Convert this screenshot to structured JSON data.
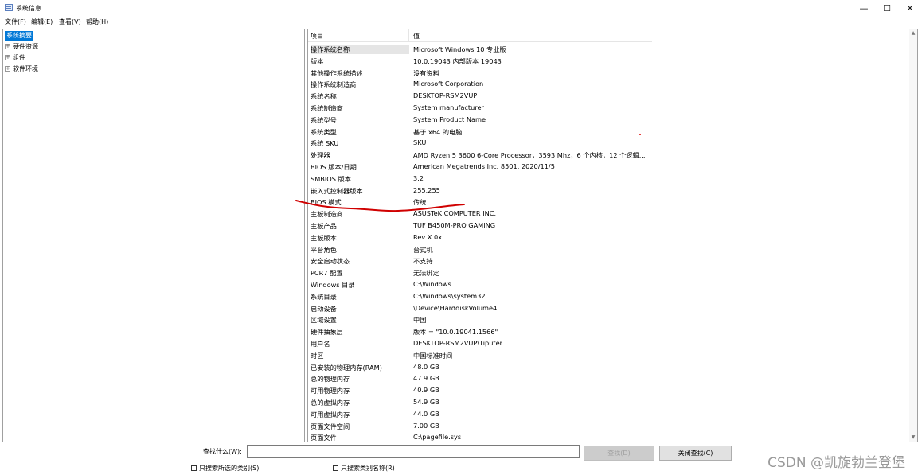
{
  "window": {
    "title": "系统信息",
    "minimize": "—",
    "maximize": "☐",
    "close": "✕"
  },
  "menu": [
    "文件(F)",
    "编辑(E)",
    "查看(V)",
    "帮助(H)"
  ],
  "tree": {
    "root": "系统摘要",
    "children": [
      "硬件资源",
      "组件",
      "软件环境"
    ]
  },
  "list": {
    "header": {
      "item": "项目",
      "value": "值"
    },
    "rows": [
      {
        "k": "操作系统名称",
        "v": "Microsoft Windows 10 专业版"
      },
      {
        "k": "版本",
        "v": "10.0.19043 内部版本 19043"
      },
      {
        "k": "其他操作系统描述",
        "v": "没有资料"
      },
      {
        "k": "操作系统制造商",
        "v": "Microsoft Corporation"
      },
      {
        "k": "系统名称",
        "v": "DESKTOP-RSM2VUP"
      },
      {
        "k": "系统制造商",
        "v": "System manufacturer"
      },
      {
        "k": "系统型号",
        "v": "System Product Name"
      },
      {
        "k": "系统类型",
        "v": "基于 x64 的电脑"
      },
      {
        "k": "系统 SKU",
        "v": "SKU"
      },
      {
        "k": "处理器",
        "v": "AMD Ryzen 5 3600 6-Core Processor，3593 Mhz，6 个内核，12 个逻辑..."
      },
      {
        "k": "BIOS 版本/日期",
        "v": "American Megatrends Inc. 8501, 2020/11/5"
      },
      {
        "k": "SMBIOS 版本",
        "v": "3.2"
      },
      {
        "k": "嵌入式控制器版本",
        "v": "255.255"
      },
      {
        "k": "BIOS 模式",
        "v": "传统"
      },
      {
        "k": "主板制造商",
        "v": "ASUSTeK COMPUTER INC."
      },
      {
        "k": "主板产品",
        "v": "TUF B450M-PRO GAMING"
      },
      {
        "k": "主板版本",
        "v": "Rev X.0x"
      },
      {
        "k": "平台角色",
        "v": "台式机"
      },
      {
        "k": "安全启动状态",
        "v": "不支持"
      },
      {
        "k": "PCR7 配置",
        "v": "无法绑定"
      },
      {
        "k": "Windows 目录",
        "v": "C:\\Windows"
      },
      {
        "k": "系统目录",
        "v": "C:\\Windows\\system32"
      },
      {
        "k": "启动设备",
        "v": "\\Device\\HarddiskVolume4"
      },
      {
        "k": "区域设置",
        "v": "中国"
      },
      {
        "k": "硬件抽象层",
        "v": "版本 = \"10.0.19041.1566\""
      },
      {
        "k": "用户名",
        "v": "DESKTOP-RSM2VUP\\Tiputer"
      },
      {
        "k": "时区",
        "v": "中国标准时间"
      },
      {
        "k": "已安装的物理内存(RAM)",
        "v": "48.0 GB"
      },
      {
        "k": "总的物理内存",
        "v": "47.9 GB"
      },
      {
        "k": "可用物理内存",
        "v": "40.9 GB"
      },
      {
        "k": "总的虚拟内存",
        "v": "54.9 GB"
      },
      {
        "k": "可用虚拟内存",
        "v": "44.0 GB"
      },
      {
        "k": "页面文件空间",
        "v": "7.00 GB"
      },
      {
        "k": "页面文件",
        "v": "C:\\pagefile.sys"
      }
    ]
  },
  "find": {
    "label": "查找什么(W):",
    "value": "",
    "find_button": "查找(D)",
    "close_find_button": "关闭查找(C)",
    "chk_selected_category": "只搜索所选的类别(S)",
    "chk_category_names": "只搜索类别名称(R)"
  },
  "watermark": "CSDN @凯旋勃兰登堡",
  "colors": {
    "selection": "#0078d7",
    "annotation": "#d00000"
  }
}
